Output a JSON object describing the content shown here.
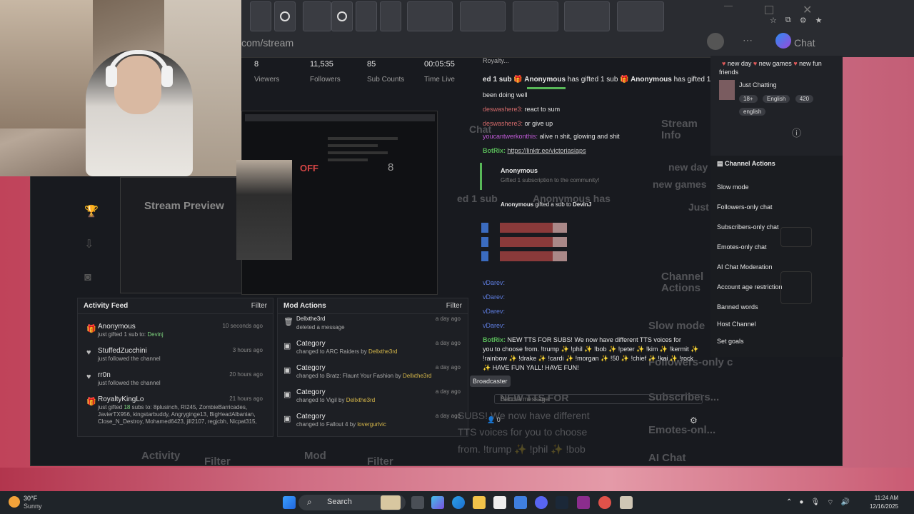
{
  "browser": {
    "url": "com/stream",
    "chat_tab": "Chat"
  },
  "stats": [
    {
      "value": "8",
      "label": "Viewers"
    },
    {
      "value": "11,535",
      "label": "Followers"
    },
    {
      "value": "85",
      "label": "Sub Counts"
    },
    {
      "value": "00:05:55",
      "label": "Time Live"
    }
  ],
  "preview": {
    "label": "Stream Preview",
    "off": "OFF",
    "count": "8"
  },
  "activity": {
    "title": "Activity Feed",
    "filter": "Filter",
    "items": [
      {
        "name": "Anonymous",
        "pre": "just gifted 1 sub to:",
        "hl": "Devinj",
        "time": "10 seconds ago"
      },
      {
        "name": "StuffedZucchini",
        "pre": "just followed the channel",
        "hl": "",
        "time": "3 hours ago"
      },
      {
        "name": "rr0n",
        "pre": "just followed the channel",
        "hl": "",
        "time": "20 hours ago"
      },
      {
        "name": "RoyaltyKingLo",
        "pre": "just gifted",
        "hl": "18",
        "post": "subs to: 8plusinch, RI245, ZombieBarricades, JavierTX956, kingstarbuddy, Angryginge13, BigHeadAlbanian, Close_N_Destroy, Mohamed6423, jill2107, regjcbh, Nicpat315,",
        "time": "21 hours ago"
      }
    ]
  },
  "mod": {
    "title": "Mod Actions",
    "filter": "Filter",
    "items": [
      {
        "name": "Dellxthe3rd",
        "sub": "deleted a message",
        "user": "",
        "time": "a day ago"
      },
      {
        "name": "Category",
        "sub": "changed to ARC Raiders by",
        "user": "Dellxthe3rd",
        "time": "a day ago"
      },
      {
        "name": "Category",
        "sub": "changed to Bratz: Flaunt Your Fashion by",
        "user": "Dellxthe3rd",
        "time": "a day ago"
      },
      {
        "name": "Category",
        "sub": "changed to Vigil by",
        "user": "Dellxthe3rd",
        "time": "a day ago"
      },
      {
        "name": "Category",
        "sub": "changed to Fallout 4 by",
        "user": "lovergurlvic",
        "time": "a day ago"
      }
    ]
  },
  "chat": {
    "top": "Royalty...",
    "banner_pre": "ed 1 sub",
    "banner_anon": "Anonymous",
    "banner_mid": "has gifted 1 sub",
    "banner_anon2": "Anonymous",
    "banner_post": "has gifted 1 s",
    "line_been": "been doing well",
    "l1_user": "deswashere3:",
    "l1_text": "react to sum",
    "l2_user": "deswashere3:",
    "l2_text": "or give up",
    "l3_user": "youcantwerkonthis:",
    "l3_text": "alive n shit, glowing and shit",
    "bot1_user": "BotRix:",
    "bot1_link": "https://linktr.ee/victoriasiaps",
    "gift_name": "Anonymous",
    "gift_text": "Gifted 1 subscription to the community!",
    "gift2_name": "Anonymous",
    "gift2_text": "gifted a sub to",
    "gift2_user": "DevinJ",
    "v1": "vDarev:",
    "v2": "vDarev:",
    "v3": "vDarev:",
    "v4": "vDarev:",
    "bot2_user": "BotRix:",
    "bot2_text1": "NEW TTS FOR SUBS! We now have different TTS voices for",
    "bot2_text2": "you to choose from. !trump ✨ !phil ✨ !bob ✨ !peter ✨ !kim ✨ !kermit ✨",
    "bot2_text3": "!rainbow ✨ !drake ✨ !cardi ✨ !morgan ✨ !50 ✨ !chief ✨ !kai ✨ !rock",
    "bot2_text4": "✨ HAVE FUN YALL! HAVE FUN!",
    "tooltip": "Broadcaster",
    "input_placeholder": "Send a message",
    "count": "0"
  },
  "stream_info": {
    "title": "Stream Info",
    "ticker_pre": "new day",
    "ticker_mid": "new games",
    "ticker_end": "new fun",
    "ticker_last": "friends",
    "category": "Just Chatting",
    "tags": [
      "18+",
      "English"
    ],
    "count": "420",
    "lang": "english"
  },
  "channel_actions": {
    "title": "Channel Actions",
    "items": [
      "Slow mode",
      "Followers-only chat",
      "Subscribers-only chat",
      "Emotes-only chat",
      "AI Chat Moderation",
      "Account age restriction",
      "Banned words",
      "Host Channel",
      "Set goals"
    ]
  },
  "ghost": {
    "chat": "Chat",
    "stream_info": "Stream Info",
    "channel_actions": "Channel Actions",
    "slow": "Slow mode",
    "followers": "Followers-only c",
    "subscribers": "Subscribers...",
    "emotes": "Emotes-onl...",
    "ai": "AI Chat",
    "activity": "Activity",
    "mod": "Mod",
    "actions": "Actions",
    "filter1": "Filter",
    "filter2": "Filter",
    "tts1": "NEW TTS FOR",
    "tts2": "SUBS! We now have different",
    "tts3": "TTS voices for you to choose",
    "tts4": "from. !trump ✨ !phil ✨ !bob",
    "gift": "ed 1 sub",
    "gift_anon": "Anonymous has",
    "ticker1": "new day",
    "ticker2": "new games",
    "just": "Just"
  },
  "taskbar": {
    "weather_temp": "30°F",
    "weather_desc": "Sunny",
    "search": "Search",
    "time": "11:24 AM",
    "date": "12/16/2025"
  }
}
